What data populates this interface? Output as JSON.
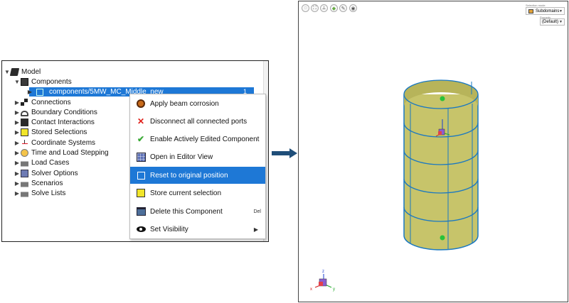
{
  "tree": {
    "root": "Model",
    "components_label": "Components",
    "selected_component": "components/5MW_MC_Middle_new",
    "selected_count": "1",
    "items": [
      "Connections",
      "Boundary Conditions",
      "Contact Interactions",
      "Stored Selections",
      "Coordinate Systems",
      "Time and Load Stepping",
      "Load Cases",
      "Solver Options",
      "Scenarios",
      "Solve Lists"
    ]
  },
  "context_menu": {
    "items": [
      {
        "label": "Apply beam corrosion",
        "icon": "corrosion-icon"
      },
      {
        "label": "Disconnect all connected ports",
        "icon": "x-icon"
      },
      {
        "label": "Enable Actively Edited Component",
        "icon": "check-icon"
      },
      {
        "label": "Open in Editor View",
        "icon": "editor-icon"
      },
      {
        "label": "Reset to original position",
        "icon": "reset-icon"
      },
      {
        "label": "Store current selection",
        "icon": "store-selection-icon"
      },
      {
        "label": "Delete this Component",
        "icon": "delete-icon",
        "shortcut": "Del"
      },
      {
        "label": "Set Visibility",
        "icon": "eye-icon"
      }
    ]
  },
  "viewer": {
    "selection_mode_label": "Selection mode",
    "selection_mode": "Subdomains",
    "property_label": "Property",
    "property_value": "(Default)",
    "axis_labels": {
      "x": "x",
      "y": "y",
      "z": "z"
    }
  },
  "colors": {
    "selection_blue": "#1e78d6",
    "cylinder_fill": "#c7c46a",
    "cylinder_lines": "#1a78c2",
    "arrow": "#1f4e79"
  }
}
